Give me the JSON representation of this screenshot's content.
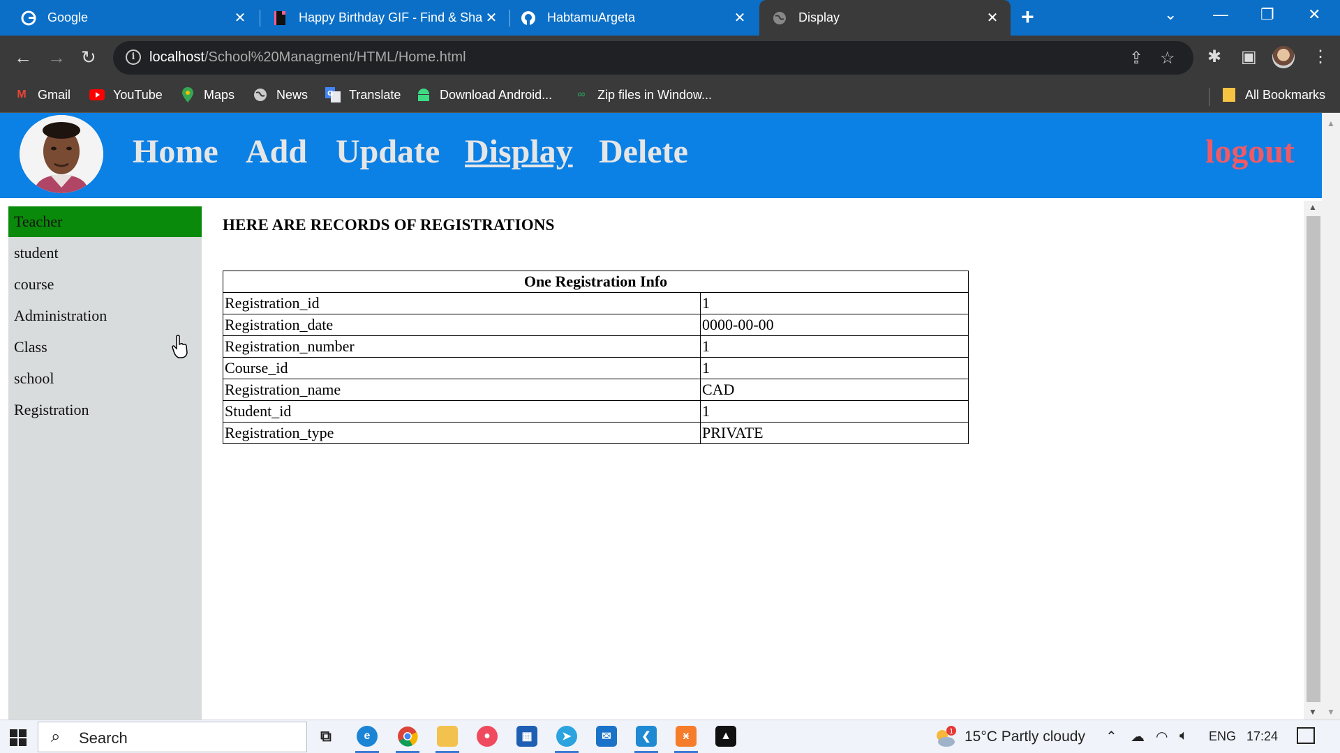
{
  "browser": {
    "tabs": [
      {
        "title": "Google",
        "icon": "google-icon"
      },
      {
        "title": "Happy Birthday GIF - Find & Sha",
        "icon": "giphy-icon"
      },
      {
        "title": "HabtamuArgeta",
        "icon": "github-icon"
      },
      {
        "title": "Display",
        "icon": "globe-icon",
        "active": true
      }
    ],
    "url_host": "localhost",
    "url_path": "/School%20Managment/HTML/Home.html",
    "bookmarks": [
      "Gmail",
      "YouTube",
      "Maps",
      "News",
      "Translate",
      "Download Android...",
      "Zip files in Window..."
    ],
    "all_bookmarks": "All Bookmarks"
  },
  "site": {
    "nav": {
      "home": "Home",
      "add": "Add",
      "update": "Update",
      "display": "Display",
      "delete": "Delete",
      "logout": "logout"
    },
    "sidebar": [
      "Teacher",
      "student",
      "course",
      "Administration",
      "Class",
      "school",
      "Registration"
    ],
    "heading": "HERE ARE RECORDS OF REGISTRATIONS",
    "table": {
      "caption": "One Registration Info",
      "rows": [
        {
          "key": "Registration_id",
          "value": "1"
        },
        {
          "key": "Registration_date",
          "value": "0000-00-00"
        },
        {
          "key": "Registration_number",
          "value": "1"
        },
        {
          "key": "Course_id",
          "value": "1"
        },
        {
          "key": "Registration_name",
          "value": "CAD"
        },
        {
          "key": "Student_id",
          "value": "1"
        },
        {
          "key": "Registration_type",
          "value": "PRIVATE"
        }
      ]
    }
  },
  "taskbar": {
    "search": "Search",
    "weather": "15°C  Partly cloudy",
    "weather_badge": "1",
    "lang": "ENG",
    "time": "17:24"
  },
  "colors": {
    "header": "#0b80e5",
    "active_sidebar": "#0a8a0a",
    "logout": "#f05a66",
    "tabbar": "#0b6fc7"
  }
}
